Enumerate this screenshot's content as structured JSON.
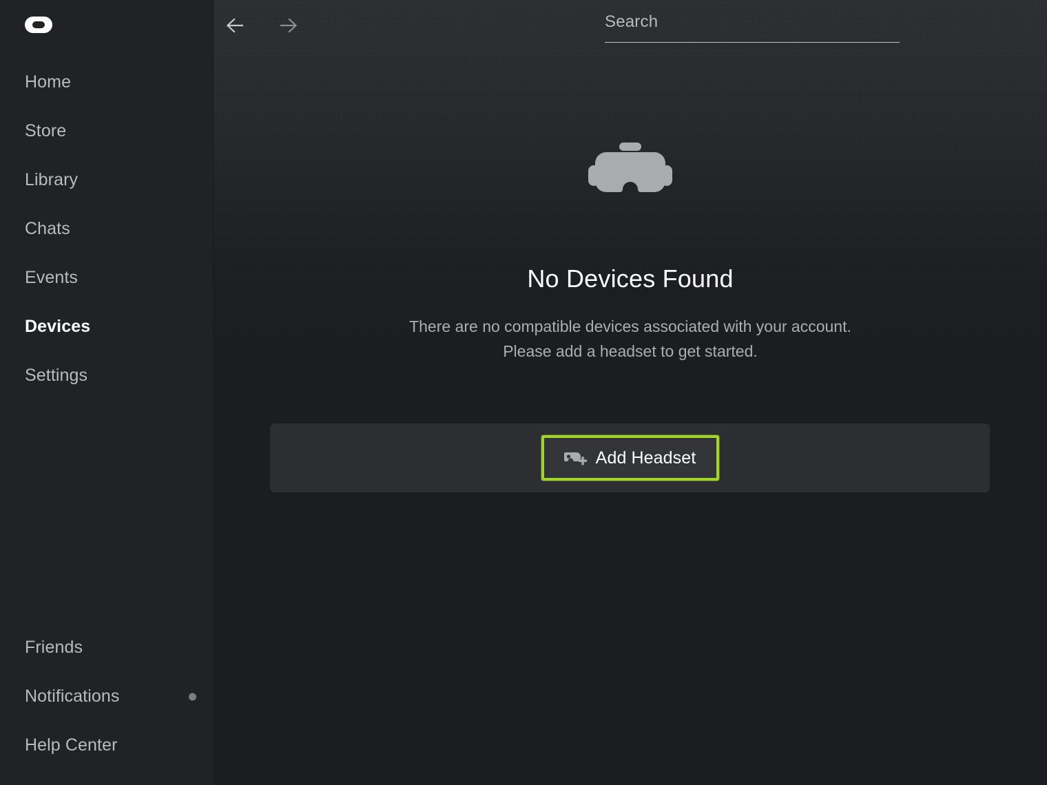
{
  "app": {
    "brand_logo": "oculus-logo",
    "accent_color": "#a4d42b",
    "sidebar_bg": "#202225",
    "content_bg": "#1b1d21",
    "panel_bg": "#2c2e31"
  },
  "titlebar": {
    "back_icon": "arrow-left-icon",
    "forward_icon": "arrow-right-icon",
    "search": {
      "value": "",
      "placeholder": "Search",
      "display_text": "Search",
      "icon": "search-icon"
    },
    "window_controls": {
      "minimize": {
        "label": "—",
        "icon": "minimize-icon"
      },
      "maximize": {
        "label": "□",
        "icon": "maximize-icon"
      },
      "close": {
        "label": "✕",
        "icon": "close-icon"
      }
    }
  },
  "sidebar": {
    "top_items": [
      {
        "label": "Home",
        "active": false,
        "badge": false
      },
      {
        "label": "Store",
        "active": false,
        "badge": false
      },
      {
        "label": "Library",
        "active": false,
        "badge": false
      },
      {
        "label": "Chats",
        "active": false,
        "badge": false
      },
      {
        "label": "Events",
        "active": false,
        "badge": false
      },
      {
        "label": "Devices",
        "active": true,
        "badge": false
      },
      {
        "label": "Settings",
        "active": false,
        "badge": false
      }
    ],
    "bottom_items": [
      {
        "label": "Friends",
        "active": false,
        "badge": false
      },
      {
        "label": "Notifications",
        "active": false,
        "badge": true
      },
      {
        "label": "Help Center",
        "active": false,
        "badge": false
      }
    ]
  },
  "main": {
    "hero_icon": "vr-headset-icon",
    "title": "No Devices Found",
    "subtitle_line_1": "There are no compatible devices associated with your account.",
    "subtitle_line_2": "Please add a headset to get started.",
    "action": {
      "button_label": "Add Headset",
      "button_icon": "add-headset-icon",
      "highlighted": true,
      "highlight_color": "#a4d42b"
    }
  }
}
